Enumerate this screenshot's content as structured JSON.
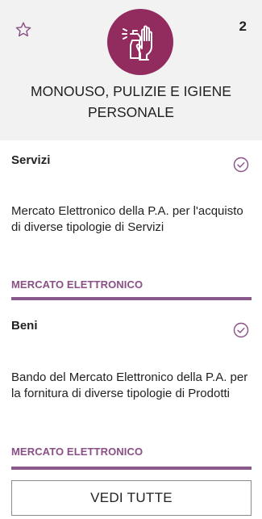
{
  "category": {
    "title": "MONOUSO, PULIZIE E IGIENE PERSONALE",
    "count": "2",
    "icon": "cleaning-spray-gloves-icon",
    "badge_color": "#922b5e"
  },
  "cards": [
    {
      "title": "Servizi",
      "description": "Mercato Elettronico della P.A. per l'acquisto di diverse tipologie di Servizi",
      "link": "MERCATO ELETTRONICO"
    },
    {
      "title": "Beni",
      "description": "Bando del Mercato Elettronico della P.A. per la fornitura di diverse tipologie di Prodotti",
      "link": "MERCATO ELETTRONICO"
    }
  ],
  "accent_color": "#8a4f86",
  "see_all_label": "VEDI TUTTE"
}
